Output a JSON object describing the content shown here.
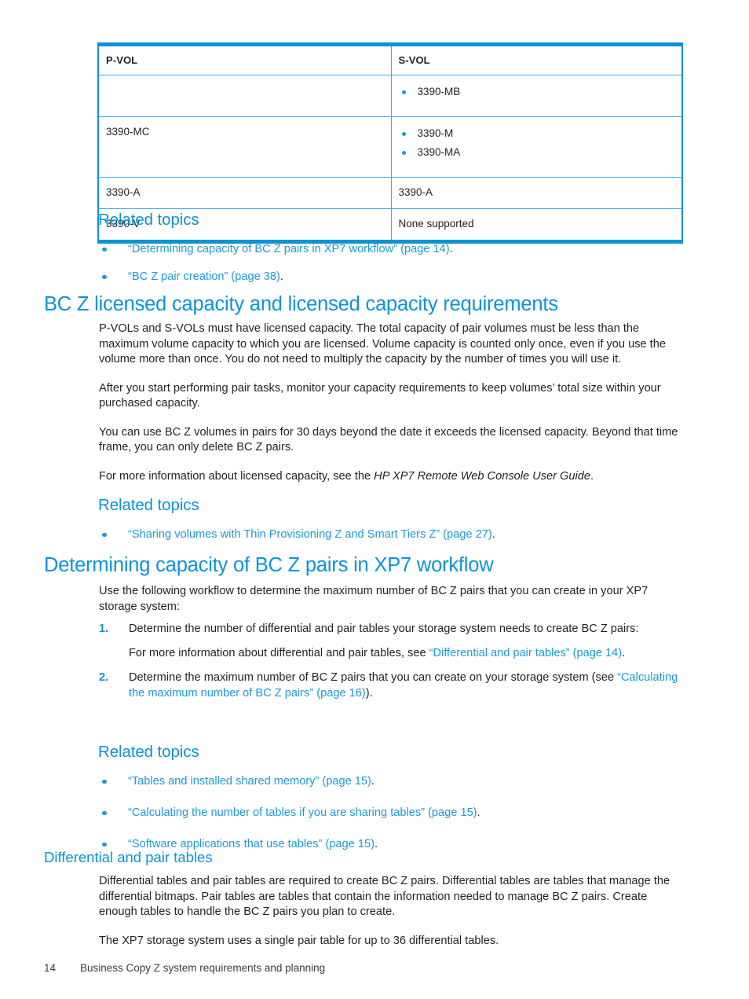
{
  "table": {
    "name": "pvol-svol-support-table",
    "columns": [
      "P-VOL",
      "S-VOL"
    ],
    "rows": [
      {
        "pvol": "",
        "svol_items": [
          "3390-MB"
        ]
      },
      {
        "pvol": "3390-MC",
        "svol_items": [
          "3390-M",
          "3390-MA"
        ]
      },
      {
        "pvol": "3390-A",
        "svol_text": "3390-A"
      },
      {
        "pvol": "3390-V",
        "svol_text": "None supported"
      }
    ]
  },
  "related_topics_1": {
    "heading": "Related topics",
    "items": [
      {
        "link": "“Determining capacity of BC Z pairs in XP7 workflow” (page 14)",
        "tail": "."
      },
      {
        "link": "“BC Z pair creation” (page 38)",
        "tail": "."
      }
    ]
  },
  "section_licensed": {
    "heading": "BC Z licensed capacity and licensed capacity requirements",
    "paragraphs": [
      "P-VOLs and S-VOLs must have licensed capacity. The total capacity of pair volumes must be less than the maximum volume capacity to which you are licensed. Volume capacity is counted only once, even if you use the volume more than once. You do not need to multiply the capacity by the number of times you will use it.",
      "After you start performing pair tasks, monitor your capacity requirements to keep volumes’ total size within your purchased capacity.",
      "You can use BC Z volumes in pairs for 30 days beyond the date it exceeds the licensed capacity. Beyond that time frame, you can only delete BC Z pairs."
    ],
    "final_para_prefix": "For more information about licensed capacity, see the ",
    "final_para_italic": "HP XP7 Remote Web Console User Guide",
    "final_para_suffix": "."
  },
  "related_topics_2": {
    "heading": "Related topics",
    "items": [
      {
        "link": "“Sharing volumes with Thin Provisioning Z and Smart Tiers Z” (page 27)",
        "tail": "."
      }
    ]
  },
  "section_determining": {
    "heading": "Determining capacity of BC Z pairs in XP7 workflow",
    "intro": "Use the following workflow to determine the maximum number of BC Z pairs that you can create in your XP7 storage system:",
    "steps": [
      {
        "number": "1.",
        "text": "Determine the number of differential and pair tables your storage system needs to create BC Z pairs:",
        "sub_prefix": "For more information about differential and pair tables, see ",
        "sub_link": "“Differential and pair tables” (page 14)",
        "sub_suffix": "."
      },
      {
        "number": "2.",
        "text_prefix": "Determine the maximum number of BC Z pairs that you can create on your storage system (see ",
        "link": "“Calculating the maximum number of BC Z pairs” (page 16)",
        "text_suffix": ")."
      }
    ]
  },
  "related_topics_3": {
    "heading": "Related topics",
    "items": [
      {
        "link": "“Tables and installed shared memory” (page 15)",
        "tail": "."
      },
      {
        "link": "“Calculating the number of tables if you are sharing tables” (page 15)",
        "tail": "."
      },
      {
        "link": "“Software applications that use tables” (page 15)",
        "tail": "."
      }
    ]
  },
  "section_differential": {
    "heading": "Differential and pair tables",
    "paragraphs": [
      "Differential tables and pair tables are required to create BC Z pairs. Differential tables are tables that manage the differential bitmaps. Pair tables are tables that contain the information needed to manage BC Z pairs. Create enough tables to handle the BC Z pairs you plan to create.",
      "The XP7 storage system uses a single pair table for up to 36 differential tables."
    ]
  },
  "footer": {
    "page_number": "14",
    "chapter_title": "Business Copy Z system requirements and planning"
  },
  "colors": {
    "accent_blue": "#0b93d5",
    "link_blue": "#1b9ad8",
    "body_text": "#231f20",
    "table_border": "#3fa9e0"
  }
}
